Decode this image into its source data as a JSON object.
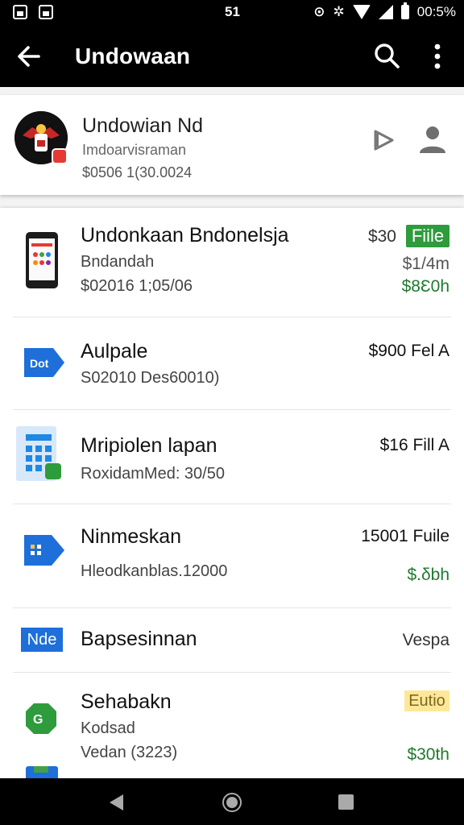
{
  "status_bar": {
    "center": "51",
    "time": "00:5%"
  },
  "app_bar": {
    "title": "Undowaan"
  },
  "profile": {
    "name": "Undowian Nd",
    "subtitle": "Imdoarvisraman",
    "meta": "$0506 1(30.0024"
  },
  "items": [
    {
      "title": "Undonkaan Bndonelsja",
      "sub1": "Bndandah",
      "sub2": "$02016 1;05/06",
      "price": "$30",
      "badge": "Fiile",
      "price2": "$1/4m",
      "price3": "$8Ɛ0h"
    },
    {
      "title": "Aulpale",
      "sub1": "S02010 Des60010)",
      "price": "$900 Fel A"
    },
    {
      "title": "Mripiolen lapan",
      "sub1": "RoxidamMed: 30/50",
      "price": "$16 Fill A"
    },
    {
      "title": "Ninmeskan",
      "sub1": "Hleodkanblas.12000",
      "price": "15001 Fuile",
      "price2": "$.δbh"
    },
    {
      "title": "Bapsesinnan",
      "icon_label": "Nde",
      "price": "Vespa"
    },
    {
      "title": "Sehabakn",
      "sub1": "Kodsad",
      "sub2": "Vedan (3223)",
      "badge": "Eutio",
      "price2": "$30th"
    }
  ],
  "icons": {
    "back": "arrow-left-icon",
    "search": "search-icon",
    "more": "more-vert-icon",
    "play": "play-icon",
    "person": "person-icon"
  },
  "colors": {
    "appbar": "#000000",
    "green_badge": "#2e9b3c",
    "price_green": "#1f7a2e",
    "accent_blue": "#1e6fd9"
  }
}
